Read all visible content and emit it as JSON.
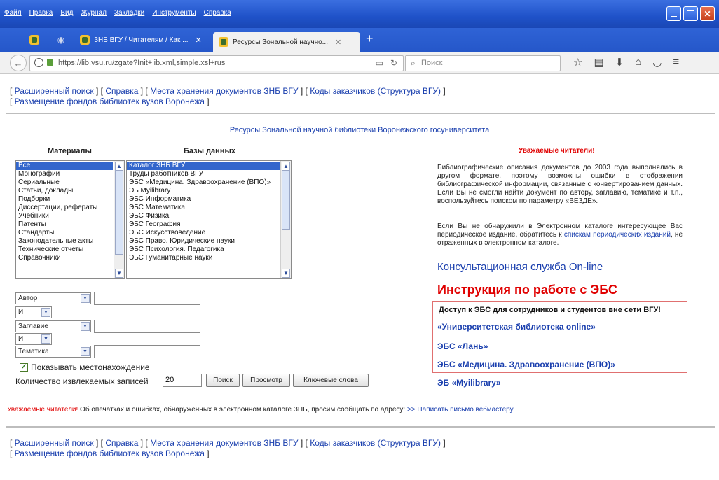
{
  "browser": {
    "menu": [
      "Файл",
      "Правка",
      "Вид",
      "Журнал",
      "Закладки",
      "Инструменты",
      "Справка"
    ],
    "tabs": [
      {
        "label": "ЗНБ ВГУ / Читателям / Как ..."
      },
      {
        "label": "Ресурсы Зональной научно..."
      }
    ],
    "url": "https://lib.vsu.ru/zgate?Init+lib.xml,simple.xsl+rus",
    "search_placeholder": "Поиск",
    "icons": [
      "star-icon",
      "bookmarks-icon",
      "download-icon",
      "home-icon",
      "pocket-icon",
      "menu-icon"
    ]
  },
  "top_links": {
    "l1": "Расширенный поиск",
    "l2": "Справка",
    "l3": "Места хранения документов ЗНБ ВГУ",
    "l4": "Коды заказчиков (Структура ВГУ)",
    "l5": "Размещение фондов библиотек вузов Воронежа"
  },
  "page_title": "Ресурсы Зональной научной библиотеки Воронежского госуниверситета",
  "materials": {
    "heading": "Материалы",
    "items": [
      "Все",
      "Монографии",
      "Сериальные",
      "Статьи, доклады",
      "Подборки",
      "Диссертации, рефераты",
      "Учебники",
      "Патенты",
      "Стандарты",
      "Законодательные акты",
      "Технические отчеты",
      "Справочники"
    ],
    "selected_index": 0
  },
  "databases": {
    "heading": "Базы данных",
    "items": [
      "Каталог ЗНБ ВГУ",
      "Труды работников ВГУ",
      "ЭБС «Медицина. Здравоохранение (ВПО)»",
      "ЭБ Myilibrary",
      "ЭБС Информатика",
      "ЭБС Математика",
      "ЭБС Физика",
      "ЭБС География",
      "ЭБС Искусствоведение",
      "ЭБС Право. Юридические науки",
      "ЭБС Психология. Педагогика",
      "ЭБС Гуманитарные науки"
    ],
    "selected_index": 0
  },
  "search_form": {
    "field1": "Автор",
    "op1": "И",
    "field2": "Заглавие",
    "op2": "И",
    "field3": "Тематика",
    "show_location": "Показывать местонахождение",
    "show_location_checked": true,
    "count_label": "Количество извлекаемых записей",
    "count_value": "20",
    "btn_search": "Поиск",
    "btn_browse": "Просмотр",
    "btn_keywords": "Ключевые слова"
  },
  "right_panel": {
    "title": "Уважаемые читатели!",
    "para1": "Библиографические описания документов до 2003 года выполнялись в другом формате, поэтому возможны ошибки в отображении библиографической информации, связанные с конвертированием данных. Если Вы не смогли найти документ по автору, заглавию, тематике и т.п., воспользуйтесь поиском по параметру «ВЕЗДЕ».",
    "para2_a": "Если Вы не обнаружили в Электронном каталоге интересующее Вас периодическое издание, обратитесь к ",
    "para2_link": "спискам периодических изданий",
    "para2_b": ", не отраженных в электронном каталоге.",
    "consult": "Консультационная служба On-line",
    "instr": "Инструкция по работе с ЭБС",
    "access_heading": "Доступ к ЭБС для сотрудников и студентов вне сети ВГУ!",
    "ebs1": "«Университетская библиотека online»",
    "ebs2": "ЭБС «Лань»",
    "ebs3": "ЭБС «Медицина. Здравоохранение (ВПО)»",
    "ebs4": "ЭБ «Myilibrary»"
  },
  "bottom_note": {
    "red": "Уважаемые читатели!",
    "text": " Об опечатках и ошибках, обнаруженных в электронном каталоге ЗНБ, просим сообщать по адресу: ",
    "link": ">> Написать письмо вебмастеру"
  },
  "colors": {
    "link": "#1a3fae",
    "alert": "#e00000",
    "selection": "#3366cc",
    "titlebar": "#1f52c9"
  }
}
